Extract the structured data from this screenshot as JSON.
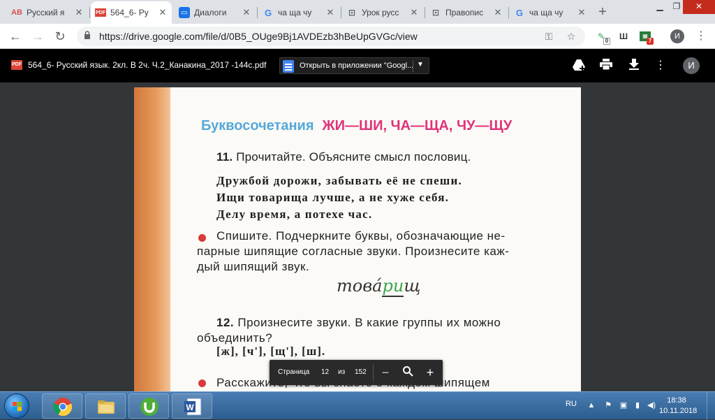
{
  "browser": {
    "tabs": [
      {
        "label": "Русский я",
        "icon": "abbyy-icon",
        "color": "#d9534f",
        "active": false
      },
      {
        "label": "564_6- Ру",
        "icon": "pdf-icon",
        "color": "#db4437",
        "active": true
      },
      {
        "label": "Диалоги",
        "icon": "chat-icon",
        "color": "#1a73e8",
        "active": false
      },
      {
        "label": "ча ща чу",
        "icon": "google-icon",
        "color": "#4285f4",
        "active": false
      },
      {
        "label": "Урок русс",
        "icon": "slides-icon",
        "color": "#5f6368",
        "active": false
      },
      {
        "label": "Правопис",
        "icon": "slides-icon",
        "color": "#5f6368",
        "active": false
      },
      {
        "label": "ча ща чу",
        "icon": "google-icon",
        "color": "#4285f4",
        "active": false
      }
    ],
    "url": "https://drive.google.com/file/d/0B5_OUge9Bj1AVDEzb3hBeUpGVGc/view",
    "profile_initial": "И",
    "extension_badge_1": "0",
    "extension_badge_2": "7"
  },
  "viewer": {
    "file_title": "564_6- Русский язык. 2кл. В 2ч. Ч.2_Канакина_2017 -144с.pdf",
    "open_with_label": "Открыть в приложении \"Googl...",
    "profile_initial": "И"
  },
  "textbook": {
    "section_title_blue": "Буквосочетания",
    "section_title_pink": "ЖИ—ШИ, ЧА—ЩА, ЧУ—ЩУ",
    "task11_number": "11.",
    "task11_text": "Прочитайте. Объясните смысл пословиц.",
    "proverbs": [
      "Дружбой дорожи, забывать её не спеши.",
      "Ищи товарища лучше, а не хуже себя.",
      "Делу время, а потехе час."
    ],
    "exercise_lines": [
      "Спишите. Подчеркните буквы, обозначающие не-",
      "парные шипящие согласные звуки. Произнесите каж-",
      "дый шипящий звук."
    ],
    "handwritten_prefix": "това",
    "handwritten_accent": "́",
    "handwritten_under": "ри",
    "handwritten_suffix": "щ",
    "task12_number": "12.",
    "task12_lines": [
      "Произнесите звуки. В какие группы их можно",
      "объединить?"
    ],
    "sounds": "[ж], [ч'], [щ'], [ш].",
    "bottom_line": "Расскажите, что вы знаете о каждом шипящем"
  },
  "page_nav": {
    "page_label": "Страница",
    "current_page": "12",
    "of_label": "из",
    "total_pages": "152"
  },
  "taskbar": {
    "language": "RU",
    "time": "18:38",
    "date": "10.11.2018"
  }
}
